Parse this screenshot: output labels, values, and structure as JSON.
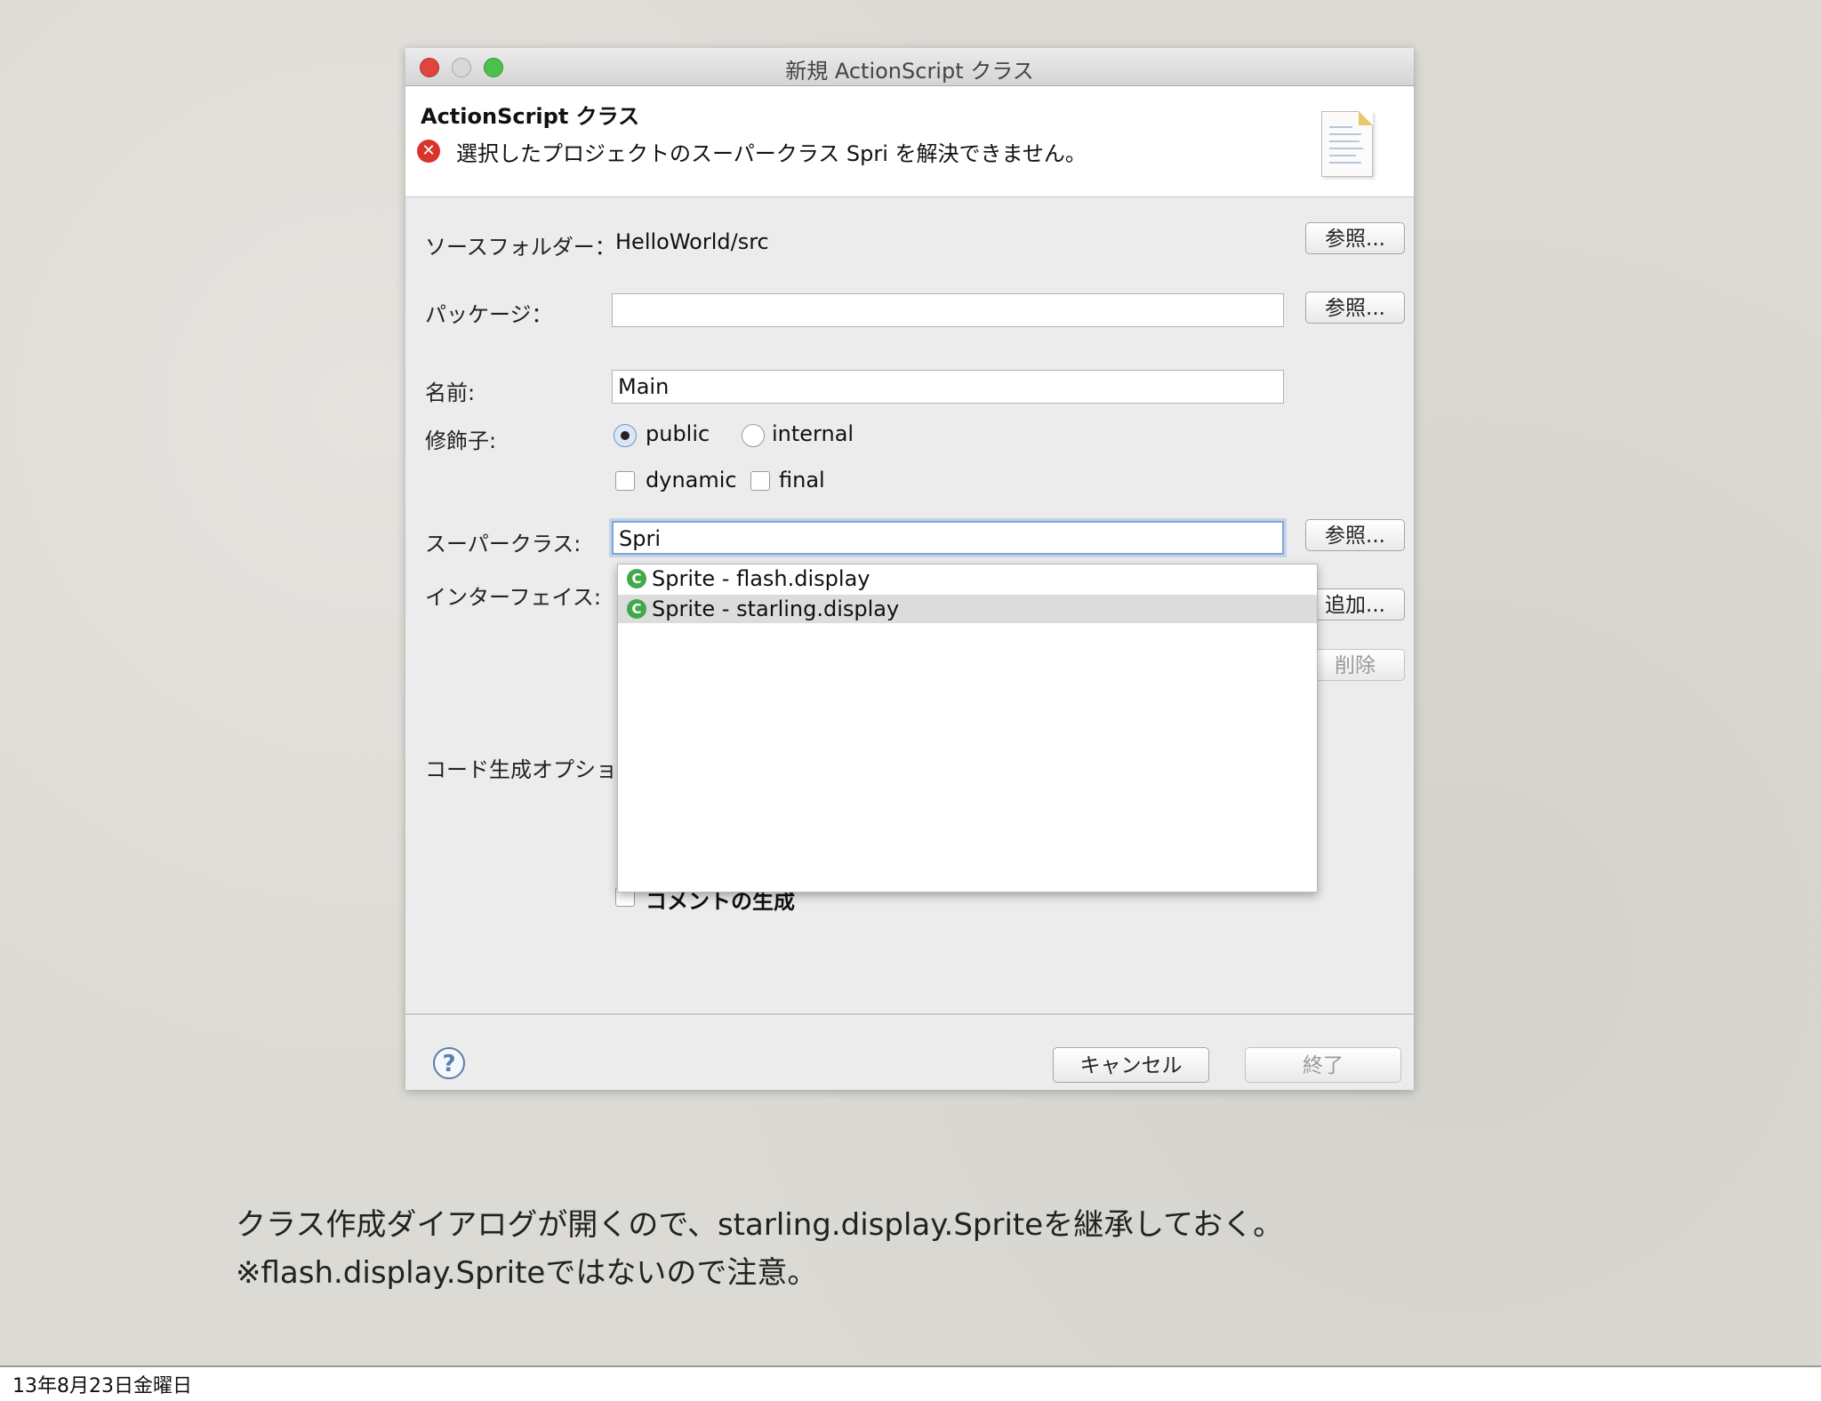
{
  "window": {
    "title": "新規 ActionScript クラス"
  },
  "header": {
    "title": "ActionScript クラス",
    "error_message": "選択したプロジェクトのスーパークラス Spri を解決できません。"
  },
  "form": {
    "source_folder_label": "ソースフォルダー：",
    "source_folder_value": "HelloWorld/src",
    "package_label": "パッケージ：",
    "package_value": "",
    "name_label": "名前:",
    "name_value": "Main",
    "modifier_label": "修飾子:",
    "modifier_public": "public",
    "modifier_internal": "internal",
    "modifier_dynamic": "dynamic",
    "modifier_final": "final",
    "superclass_label": "スーパークラス:",
    "superclass_value": "Spri",
    "interface_label": "インターフェイス:",
    "codegen_label": "コード生成オプション",
    "comment_gen_label": "コメントの生成",
    "browse_label": "参照...",
    "add_label": "追加...",
    "remove_label": "削除"
  },
  "autocomplete": {
    "items": [
      {
        "text": "Sprite - flash.display",
        "selected": false
      },
      {
        "text": "Sprite - starling.display",
        "selected": true
      }
    ]
  },
  "footer": {
    "cancel_label": "キャンセル",
    "finish_label": "終了"
  },
  "caption": {
    "line1": "クラス作成ダイアログが開くので、starling.display.Spriteを継承しておく。",
    "line2": "※flash.display.Spriteではないので注意。"
  },
  "slide_footer": {
    "date": "13年8月23日金曜日"
  }
}
